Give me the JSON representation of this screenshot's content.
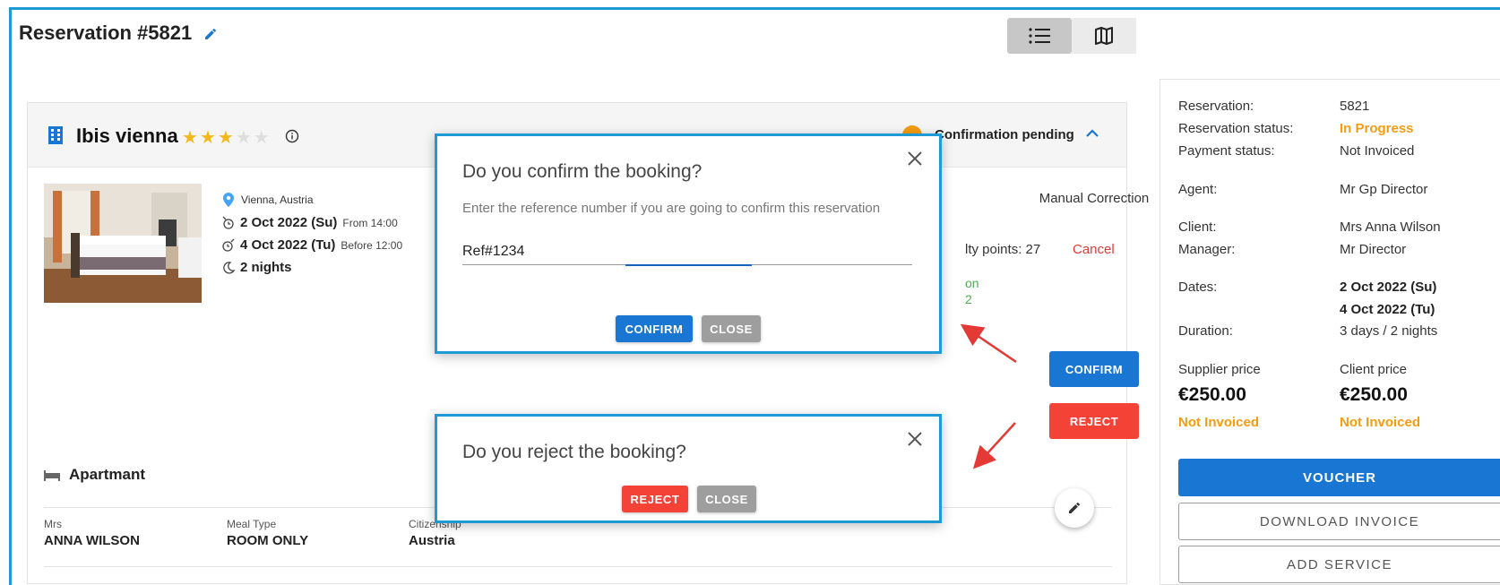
{
  "page": {
    "title": "Reservation #5821"
  },
  "view_toggle": {
    "list_icon": "list-icon",
    "map_icon": "map-icon"
  },
  "hotel": {
    "name": "Ibis vienna",
    "stars_filled": 3,
    "stars_total": 5,
    "status": "Confirmation pending",
    "location": "Vienna, Austria",
    "checkin_date": "2 Oct 2022 (Su)",
    "checkin_note": "From 14:00",
    "checkout_date": "4 Oct 2022 (Tu)",
    "checkout_note": "Before 12:00",
    "nights": "2 nights",
    "manual_correction": "Manual Correction",
    "loyalty_points": "lty points: 27",
    "cancel": "Cancel",
    "partial_green_1": "on",
    "partial_green_2": "2",
    "confirm_button": "CONFIRM",
    "reject_button": "REJECT",
    "room_type": "Apartmant",
    "guests": [
      {
        "label": "Mrs",
        "value": "ANNA WILSON"
      },
      {
        "label": "Meal Type",
        "value": "ROOM ONLY"
      },
      {
        "label": "Citizenship",
        "value": "Austria"
      }
    ],
    "colors": {
      "status_dot": "#f39c12",
      "star_on": "#f5b81c",
      "confirm": "#1976d2",
      "reject": "#f44336"
    }
  },
  "confirm_dialog": {
    "title": "Do you confirm the booking?",
    "subtitle": "Enter the reference number if you are going to confirm this reservation",
    "input_value": "Ref#1234",
    "confirm_button": "CONFIRM",
    "close_button": "CLOSE"
  },
  "reject_dialog": {
    "title": "Do you reject the booking?",
    "reject_button": "REJECT",
    "close_button": "CLOSE"
  },
  "summary": {
    "reservation_label": "Reservation:",
    "reservation_value": "5821",
    "reservation_status_label": "Reservation status:",
    "reservation_status_value": "In Progress",
    "payment_status_label": "Payment status:",
    "payment_status_value": "Not Invoiced",
    "agent_label": "Agent:",
    "agent_value": "Mr Gp Director",
    "client_label": "Client:",
    "client_value": "Mrs Anna Wilson",
    "manager_label": "Manager:",
    "manager_value": "Mr Director",
    "dates_label": "Dates:",
    "date_from": "2 Oct 2022 (Su)",
    "date_to": "4 Oct 2022 (Tu)",
    "duration_label": "Duration:",
    "duration_value": "3 days / 2 nights",
    "supplier_price_label": "Supplier price",
    "supplier_price_value": "€250.00",
    "supplier_invoice_status": "Not Invoiced",
    "client_price_label": "Client price",
    "client_price_value": "€250.00",
    "client_invoice_status": "Not Invoiced",
    "voucher_button": "VOUCHER",
    "download_invoice_button": "DOWNLOAD INVOICE",
    "add_service_button": "ADD SERVICE"
  }
}
